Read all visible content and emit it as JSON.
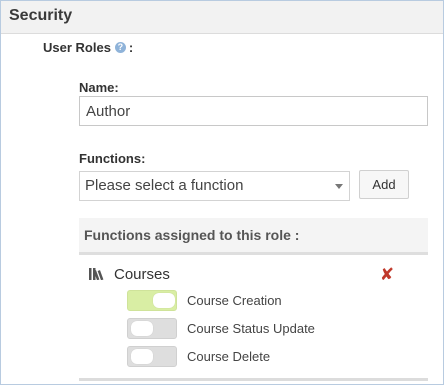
{
  "section": {
    "title": "Security"
  },
  "user_roles": {
    "label": "User Roles",
    "help_glyph": "?",
    "suffix": ":"
  },
  "name_field": {
    "label": "Name:",
    "value": "Author"
  },
  "functions_field": {
    "label": "Functions:",
    "select_value": "Please select a function",
    "add_label": "Add"
  },
  "assigned": {
    "title": "Functions assigned to this role :",
    "groups": [
      {
        "label": "Courses",
        "remove_glyph": "✘",
        "functions": [
          {
            "label": "Course Creation",
            "enabled": true
          },
          {
            "label": "Course Status Update",
            "enabled": false
          },
          {
            "label": "Course Delete",
            "enabled": false
          }
        ]
      }
    ]
  },
  "colors": {
    "toggle_on": "#d9eea4",
    "toggle_off": "#dedede",
    "remove": "#c0392b",
    "help": "#8fb3d9"
  }
}
